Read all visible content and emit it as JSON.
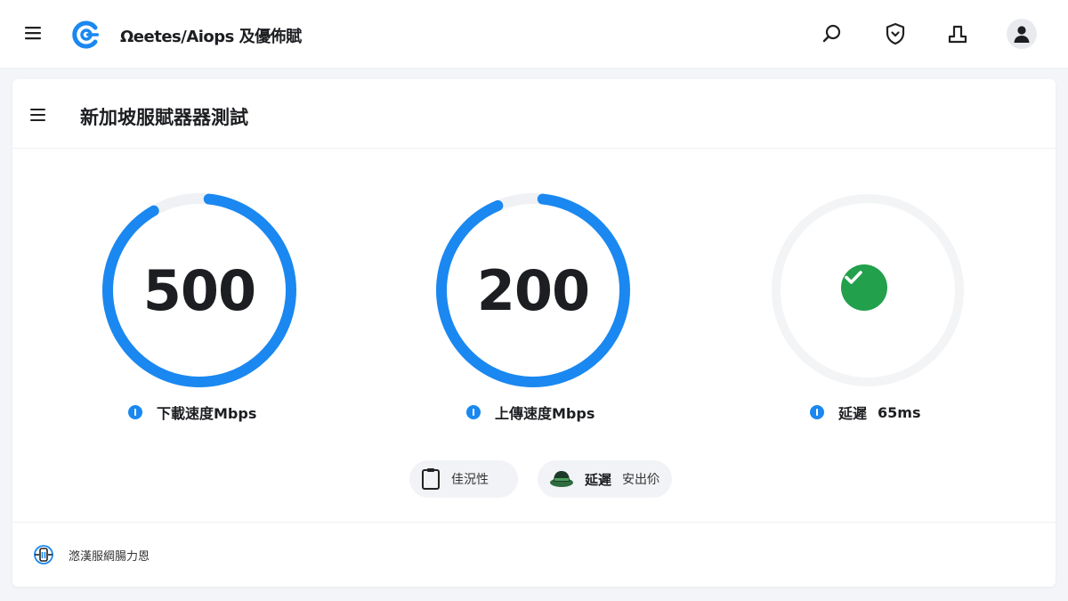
{
  "header": {
    "app_title": "Ωeetes/Aiops 及優佈賦",
    "icons": [
      "menu-icon",
      "app-logo-icon",
      "search-icon",
      "shield-icon",
      "share-icon",
      "user-icon"
    ]
  },
  "card": {
    "title": "新加坡服賦器器測試"
  },
  "metrics": {
    "download": {
      "value": "500",
      "label": "下載速度Mbps",
      "progress": 0.9
    },
    "upload": {
      "value": "200",
      "label": "上傳速度Mbps",
      "progress": 0.92
    },
    "latency": {
      "label": "延遲",
      "value": "65ms",
      "status": "ok"
    }
  },
  "actions": {
    "first": {
      "label": "佳況性"
    },
    "second": {
      "strong": "延遲",
      "label": "安出伱"
    }
  },
  "footer": {
    "text": "滺漢服綱腸力恩"
  },
  "colors": {
    "accent": "#1a88f0",
    "track": "#f0f1f4",
    "success": "#22a04b"
  }
}
